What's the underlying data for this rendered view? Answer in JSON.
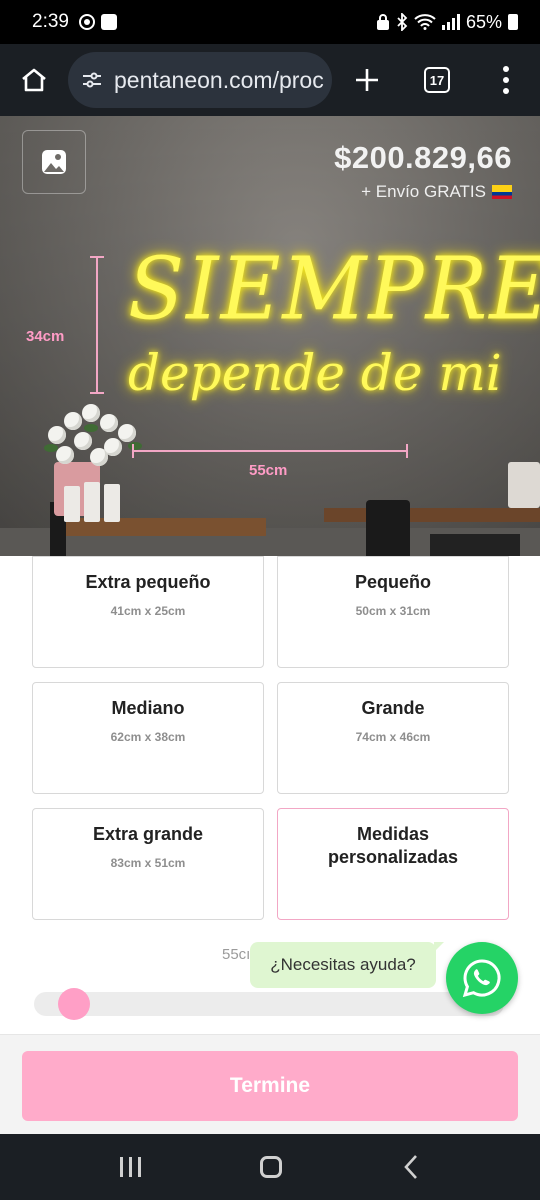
{
  "status_bar": {
    "time": "2:39",
    "battery": "65%"
  },
  "browser": {
    "url": "pentaneon.com/proc",
    "tab_count": "17"
  },
  "hero": {
    "price": "$200.829,66",
    "shipping": "+ Envío GRATIS",
    "neon_line1": "SIEMPRE",
    "neon_line2": "depende de mi",
    "height_label": "34cm",
    "width_label": "55cm"
  },
  "sizes": [
    {
      "name": "Extra pequeño",
      "dims": "41cm x 25cm"
    },
    {
      "name": "Pequeño",
      "dims": "50cm x 31cm"
    },
    {
      "name": "Mediano",
      "dims": "62cm x 38cm"
    },
    {
      "name": "Grande",
      "dims": "74cm x 46cm"
    },
    {
      "name": "Extra grande",
      "dims": "83cm x 51cm"
    },
    {
      "name": "Medidas personalizadas",
      "dims": ""
    }
  ],
  "slider": {
    "label": "55cı",
    "value_fraction": 0.08
  },
  "help": {
    "text": "¿Necesitas ayuda?"
  },
  "cta": {
    "label": "Termine"
  },
  "colors": {
    "accent_pink": "#ffabca",
    "neon_yellow": "#fff95a",
    "whatsapp_green": "#25d366"
  }
}
